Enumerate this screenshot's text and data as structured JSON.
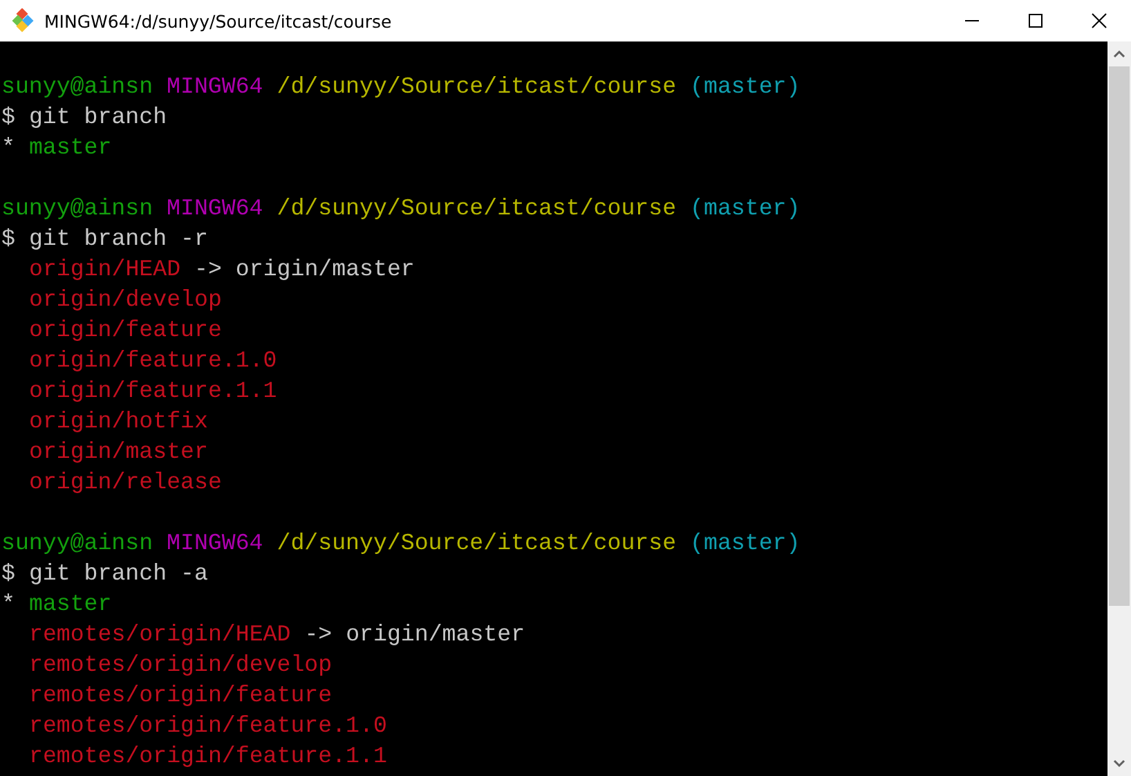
{
  "window": {
    "title": "MINGW64:/d/sunyy/Source/itcast/course"
  },
  "terminal": {
    "lines": [
      {
        "kind": "blank"
      },
      {
        "kind": "prompt",
        "user": "sunyy@ainsn",
        "system": "MINGW64",
        "path": "/d/sunyy/Source/itcast/course",
        "branch": "(master)"
      },
      {
        "kind": "command",
        "prompt": "$",
        "text": "git branch"
      },
      {
        "kind": "current",
        "marker": "*",
        "text": "master"
      },
      {
        "kind": "blank"
      },
      {
        "kind": "prompt",
        "user": "sunyy@ainsn",
        "system": "MINGW64",
        "path": "/d/sunyy/Source/itcast/course",
        "branch": "(master)"
      },
      {
        "kind": "command",
        "prompt": "$",
        "text": "git branch -r"
      },
      {
        "kind": "remote",
        "text": "origin/HEAD",
        "target": "-> origin/master"
      },
      {
        "kind": "remote",
        "text": "origin/develop"
      },
      {
        "kind": "remote",
        "text": "origin/feature"
      },
      {
        "kind": "remote",
        "text": "origin/feature.1.0"
      },
      {
        "kind": "remote",
        "text": "origin/feature.1.1"
      },
      {
        "kind": "remote",
        "text": "origin/hotfix"
      },
      {
        "kind": "remote",
        "text": "origin/master"
      },
      {
        "kind": "remote",
        "text": "origin/release"
      },
      {
        "kind": "blank"
      },
      {
        "kind": "prompt",
        "user": "sunyy@ainsn",
        "system": "MINGW64",
        "path": "/d/sunyy/Source/itcast/course",
        "branch": "(master)"
      },
      {
        "kind": "command",
        "prompt": "$",
        "text": "git branch -a"
      },
      {
        "kind": "current",
        "marker": "*",
        "text": "master"
      },
      {
        "kind": "remote",
        "text": "remotes/origin/HEAD",
        "target": "-> origin/master"
      },
      {
        "kind": "remote",
        "text": "remotes/origin/develop"
      },
      {
        "kind": "remote",
        "text": "remotes/origin/feature"
      },
      {
        "kind": "remote",
        "text": "remotes/origin/feature.1.0"
      },
      {
        "kind": "remote",
        "text": "remotes/origin/feature.1.1"
      }
    ]
  }
}
